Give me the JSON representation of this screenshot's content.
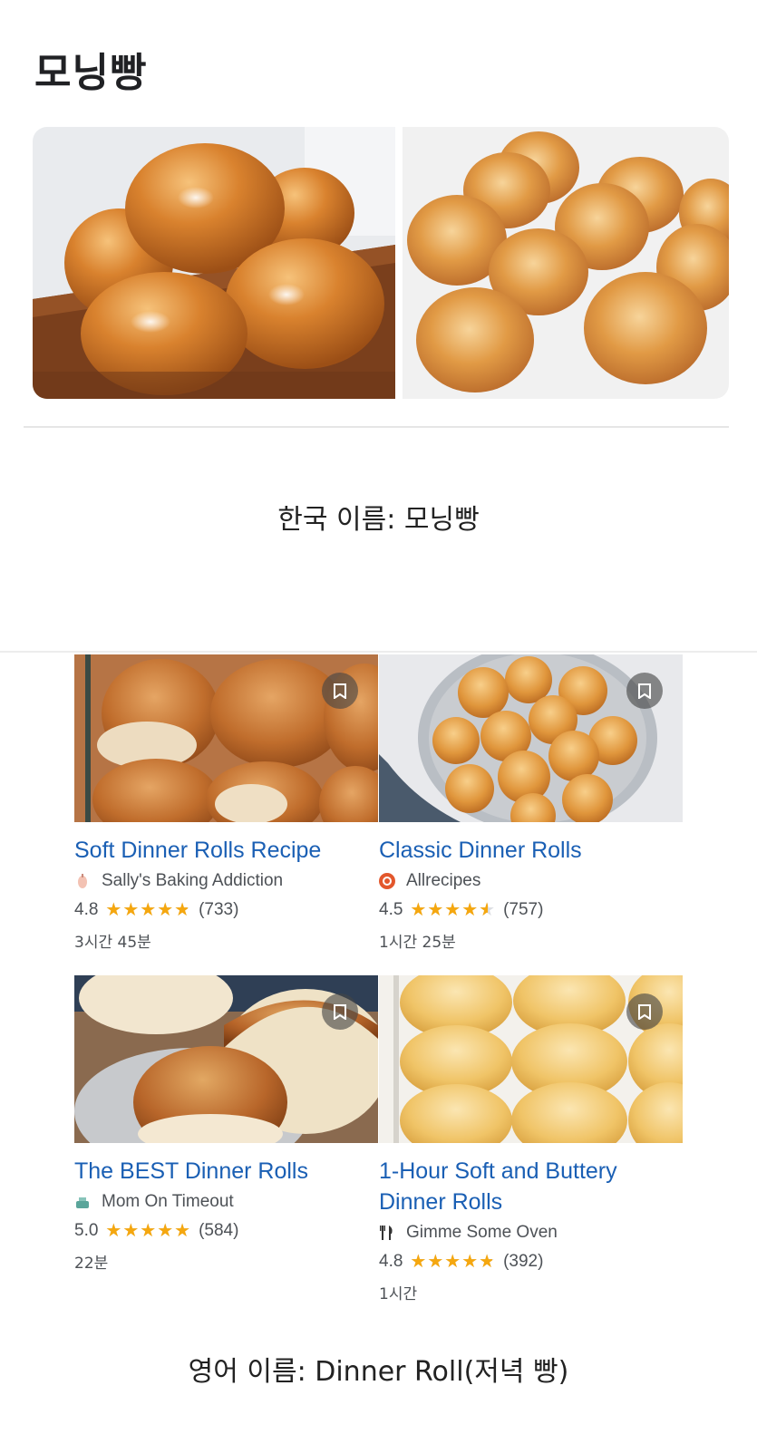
{
  "header": {
    "title": "모닝빵"
  },
  "captions": {
    "korean_name": "한국 이름: 모닝빵",
    "english_name": "영어 이름: Dinner Roll(저녁 빵)"
  },
  "recipes": [
    {
      "title": "Soft Dinner Rolls Recipe",
      "source": "Sally's Baking Addiction",
      "rating": "4.8",
      "rating_fraction": 0.96,
      "reviews": "(733)",
      "time": "3시간 45분",
      "source_icon": "whisk-icon"
    },
    {
      "title": "Classic Dinner Rolls",
      "source": "Allrecipes",
      "rating": "4.5",
      "rating_fraction": 0.9,
      "reviews": "(757)",
      "time": "1시간 25분",
      "source_icon": "allrecipes-logo-icon"
    },
    {
      "title": "The BEST Dinner Rolls",
      "source": "Mom On Timeout",
      "rating": "5.0",
      "rating_fraction": 1.0,
      "reviews": "(584)",
      "time": "22분",
      "source_icon": "cooking-pot-icon"
    },
    {
      "title": "1-Hour Soft and Buttery Dinner Rolls",
      "source": "Gimme Some Oven",
      "rating": "4.8",
      "rating_fraction": 0.96,
      "reviews": "(392)",
      "time": "1시간",
      "source_icon": "fork-knife-icon"
    }
  ],
  "colors": {
    "link": "#1a5fb4",
    "star": "#f5a70f",
    "muted": "#4d5156"
  }
}
